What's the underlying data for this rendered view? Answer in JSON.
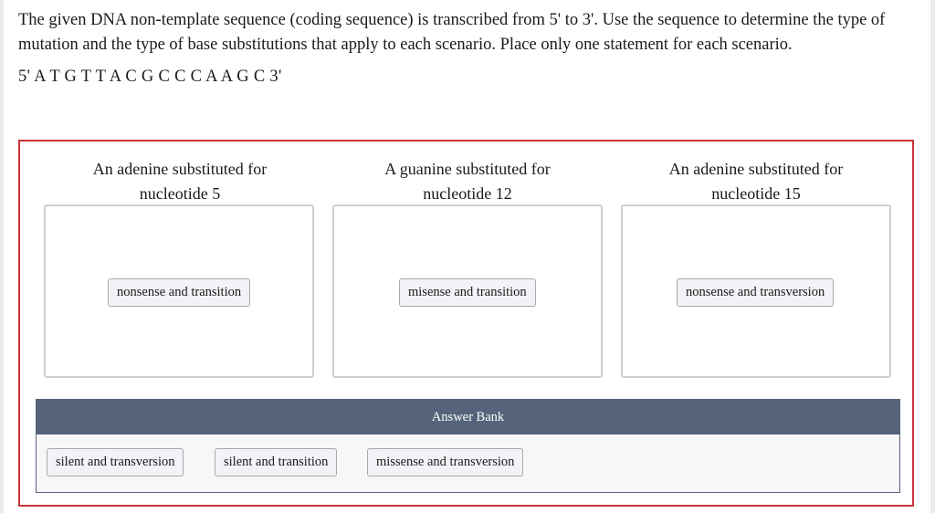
{
  "prompt": "The given DNA non-template sequence (coding sequence) is transcribed from 5' to 3'. Use the sequence to determine the type of mutation and the type of base substitutions that apply to each scenario. Place only one statement for each scenario.",
  "sequence": "5' A T G T T A C G C C C A A G C 3'",
  "scenarios": [
    {
      "label_line1": "An adenine substituted for",
      "label_line2": "nucleotide 5",
      "placed_answer": "nonsense and transition"
    },
    {
      "label_line1": "A guanine substituted for",
      "label_line2": "nucleotide 12",
      "placed_answer": "misense and transition"
    },
    {
      "label_line1": "An adenine substituted for",
      "label_line2": "nucleotide 15",
      "placed_answer": "nonsense and transversion"
    }
  ],
  "answer_bank": {
    "title": "Answer Bank",
    "items": [
      "silent and transversion",
      "silent and transition",
      "missense and transversion"
    ]
  }
}
